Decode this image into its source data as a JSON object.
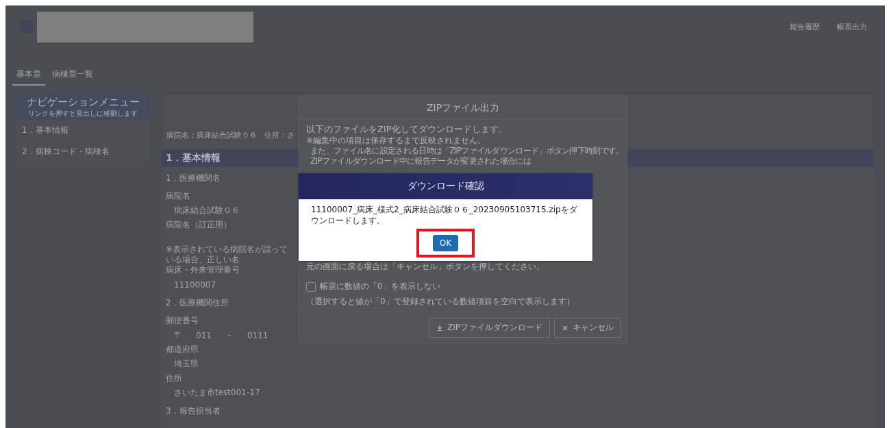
{
  "header": {
    "links": [
      "報告履歴",
      "帳票出力"
    ]
  },
  "tabs": [
    {
      "label": "基本票",
      "selected": true
    },
    {
      "label": "病棟票一覧",
      "selected": false
    }
  ],
  "nav": {
    "title": "ナビゲーションメニュー",
    "subtitle": "リンクを押すと見出しに移動します",
    "items": [
      "1．基本情報",
      "2．病棟コード・病棟名"
    ]
  },
  "content": {
    "summary": "病院名：病床結合試験０６　住所：さ",
    "section": "1．基本情報",
    "rows": [
      {
        "kind": "subheading",
        "text": "1．医療機関名"
      },
      {
        "kind": "label",
        "text": "病院名"
      },
      {
        "kind": "value",
        "text": "病床結合試験０６"
      },
      {
        "kind": "label",
        "text": "病院名（訂正用）"
      },
      {
        "kind": "spacer"
      },
      {
        "kind": "note",
        "text": "※表示されている病院名が誤っている場合、正しい名"
      },
      {
        "kind": "label",
        "text": "病床・外来管理番号"
      },
      {
        "kind": "value",
        "text": "11100007"
      },
      {
        "kind": "subheading",
        "text": "2．医療機関住所"
      },
      {
        "kind": "label",
        "text": "郵便番号"
      },
      {
        "kind": "postal",
        "mark": "〒",
        "first": "011",
        "sep": "－",
        "second": "0111"
      },
      {
        "kind": "label",
        "text": "都道府県"
      },
      {
        "kind": "value",
        "text": "埼玉県"
      },
      {
        "kind": "label",
        "text": "住所"
      },
      {
        "kind": "value",
        "text": "さいたま市test001-17"
      },
      {
        "kind": "subheading",
        "text": "3．報告担当者"
      }
    ]
  },
  "zip_dialog": {
    "title": "ZIPファイル出力",
    "lines": [
      {
        "kind": "lead",
        "text": "以下のファイルをZIP化してダウンロードします。"
      },
      {
        "kind": "note",
        "text": "※編集中の項目は保存するまで反映されません。"
      },
      {
        "kind": "indent",
        "text": "また、ファイル名に設定される日時は「ZIPファイルダウンロード」ボタン押下時刻です。"
      },
      {
        "kind": "indent",
        "text": "ZIPファイルダウンロード中に報告データが変更された場合には"
      }
    ],
    "cancel_hint": "元の画面に戻る場合は「キャンセル」ボタンを押してください。",
    "checkbox": {
      "label": "帳票に数値の「0」を表示しない",
      "checked": false
    },
    "checkbox_hint": "（選択すると値が「0」で登録されている数値項目を空白で表示します）",
    "buttons": [
      {
        "kind": "download",
        "label": "ZIPファイルダウンロード"
      },
      {
        "kind": "close",
        "label": "キャンセル"
      }
    ]
  },
  "confirm_dialog": {
    "title": "ダウンロード確認",
    "message": "11100007_病床_様式2_病床結合試験０６_20230905103715.zipをダウンロードします。",
    "ok": "OK",
    "highlighted": true
  }
}
